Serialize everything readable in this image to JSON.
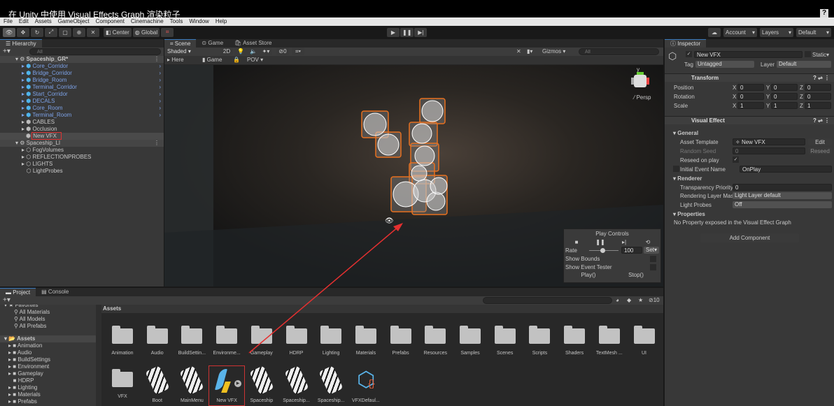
{
  "title": "在 Unity 中使用 Visual Effects Graph 渲染粒子",
  "menu": [
    "File",
    "Edit",
    "Assets",
    "GameObject",
    "Component",
    "Cinemachine",
    "Tools",
    "Window",
    "Help"
  ],
  "toolbar": {
    "center": "Center",
    "global": "Global",
    "account": "Account",
    "layers": "Layers",
    "layout": "Default"
  },
  "hierarchy": {
    "tab": "Hierarchy",
    "search_placeholder": "All",
    "scene1": "Spaceship_GR*",
    "items1": [
      {
        "label": "Core_Corridor",
        "prefab": true
      },
      {
        "label": "Bridge_Corridor",
        "prefab": true
      },
      {
        "label": "Bridge_Room",
        "prefab": true
      },
      {
        "label": "Terminal_Corridor",
        "prefab": true
      },
      {
        "label": "Start_Corridor",
        "prefab": true
      },
      {
        "label": "DECALS",
        "prefab": true
      },
      {
        "label": "Core_Room",
        "prefab": true
      },
      {
        "label": "Terminal_Room",
        "prefab": true
      },
      {
        "label": "CABLES",
        "prefab": false
      },
      {
        "label": "Occlusion",
        "prefab": false
      },
      {
        "label": "New VFX",
        "prefab": false,
        "selected": true
      }
    ],
    "scene2": "Spaceship_LI",
    "items2": [
      "FogVolumes",
      "REFLECTIONPROBES",
      "LIGHTS",
      "LightProbes"
    ]
  },
  "scene": {
    "tabs": [
      "Scene",
      "Game",
      "Asset Store"
    ],
    "shading": "Shaded",
    "mode2d": "2D",
    "fx_count": "0",
    "here": "Here",
    "game": "Game",
    "pov": "POV",
    "gizmos": "Gizmos",
    "search_placeholder": "All",
    "persp": "Persp",
    "axis_y": "y",
    "play_controls": {
      "title": "Play Controls",
      "rate_label": "Rate",
      "rate": "100",
      "rate_fraction": 0.45,
      "set": "Set",
      "show_bounds": "Show Bounds",
      "show_event_tester": "Show Event Tester",
      "play": "Play()",
      "stop": "Stop()"
    }
  },
  "inspector": {
    "tab": "Inspector",
    "name": "New VFX",
    "static": "Static",
    "tag_label": "Tag",
    "tag": "Untagged",
    "layer_label": "Layer",
    "layer": "Default",
    "transform": {
      "title": "Transform",
      "rows": [
        {
          "label": "Position",
          "x": "0",
          "y": "0",
          "z": "0"
        },
        {
          "label": "Rotation",
          "x": "0",
          "y": "0",
          "z": "0"
        },
        {
          "label": "Scale",
          "x": "1",
          "y": "1",
          "z": "1"
        }
      ]
    },
    "vfx": {
      "title": "Visual Effect",
      "general": "General",
      "asset_template_label": "Asset Template",
      "asset_template": "New VFX",
      "edit": "Edit",
      "random_seed_label": "Random Seed",
      "random_seed": "0",
      "reseed": "Reseed",
      "reseed_on_play": "Reseed on play",
      "initial_event_label": "Initial Event Name",
      "initial_event": "OnPlay",
      "renderer": "Renderer",
      "transparency_label": "Transparency Priority",
      "transparency": "0",
      "rendering_layer_label": "Rendering Layer Mas",
      "rendering_layer": "Light Layer default",
      "light_probes_label": "Light Probes",
      "light_probes": "Off",
      "properties": "Properties",
      "no_property": "No Property exposed in the Visual Effect Graph"
    },
    "add_component": "Add Component"
  },
  "project": {
    "tabs": [
      "Project",
      "Console"
    ],
    "favorites": "Favorites",
    "fav_items": [
      "All Materials",
      "All Models",
      "All Prefabs"
    ],
    "assets_root": "Assets",
    "tree": [
      "Animation",
      "Audio",
      "BuildSettings",
      "Environment",
      "Gameplay",
      "HDRP",
      "Lighting",
      "Materials",
      "Prefabs"
    ],
    "breadcrumb": "Assets",
    "hidden_count": "10",
    "row1": [
      "Animation",
      "Audio",
      "BuildSettin...",
      "Environme...",
      "Gameplay",
      "HDRP",
      "Lighting",
      "Materials",
      "Prefabs",
      "Resources",
      "Samples",
      "Scenes",
      "Scripts",
      "Shaders",
      "TextMesh ...",
      "UI"
    ],
    "row2": [
      {
        "label": "VFX",
        "type": "folder"
      },
      {
        "label": "Boot",
        "type": "prefab"
      },
      {
        "label": "MainMenu",
        "type": "prefab"
      },
      {
        "label": "New VFX",
        "type": "vfx"
      },
      {
        "label": "Spaceship",
        "type": "prefab"
      },
      {
        "label": "Spaceship...",
        "type": "prefab"
      },
      {
        "label": "Spaceship...",
        "type": "prefab"
      },
      {
        "label": "VFXDefaul...",
        "type": "script"
      }
    ]
  },
  "colors": {
    "accent": "#3a79bb",
    "prefab_text": "#7ca1e6",
    "highlight": "#e03030",
    "gizmo": "#e8701f"
  }
}
